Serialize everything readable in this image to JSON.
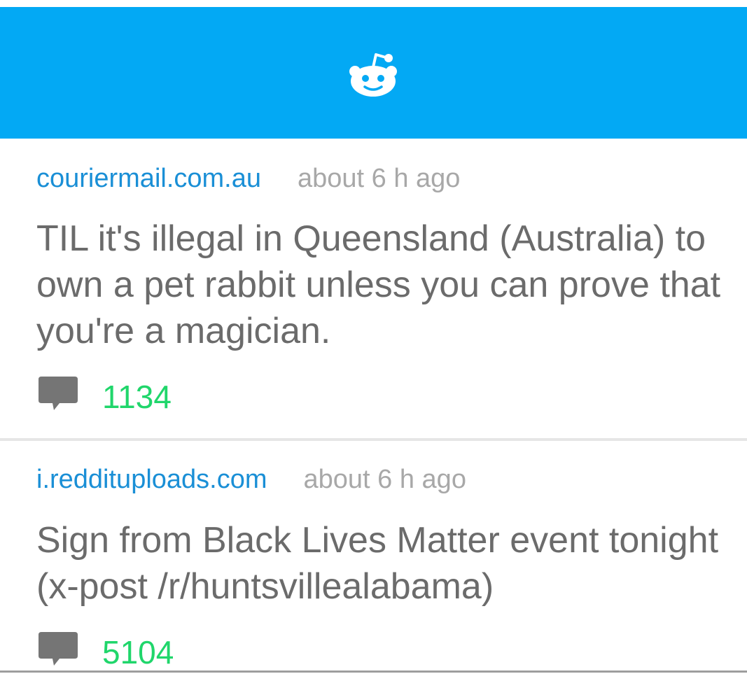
{
  "appbar": {
    "logo_icon": "reddit-alien-icon",
    "color": "#03a9f4"
  },
  "posts": [
    {
      "domain": "couriermail.com.au",
      "time": "about 6 h ago",
      "title": "TIL it's illegal in Queensland (Australia) to own a pet rabbit unless you can prove that you're a magician.",
      "comment_icon": "comment-icon",
      "comments": "1134"
    },
    {
      "domain": "i.reddituploads.com",
      "time": "about 6 h ago",
      "title": "Sign from Black Lives Matter event tonight (x-post /r/huntsvillealabama)",
      "comment_icon": "comment-icon",
      "comments": "5104"
    }
  ],
  "colors": {
    "domain": "#1a8fd6",
    "time": "#a8a8a8",
    "title": "#6b6b6b",
    "comments": "#20d66b"
  }
}
